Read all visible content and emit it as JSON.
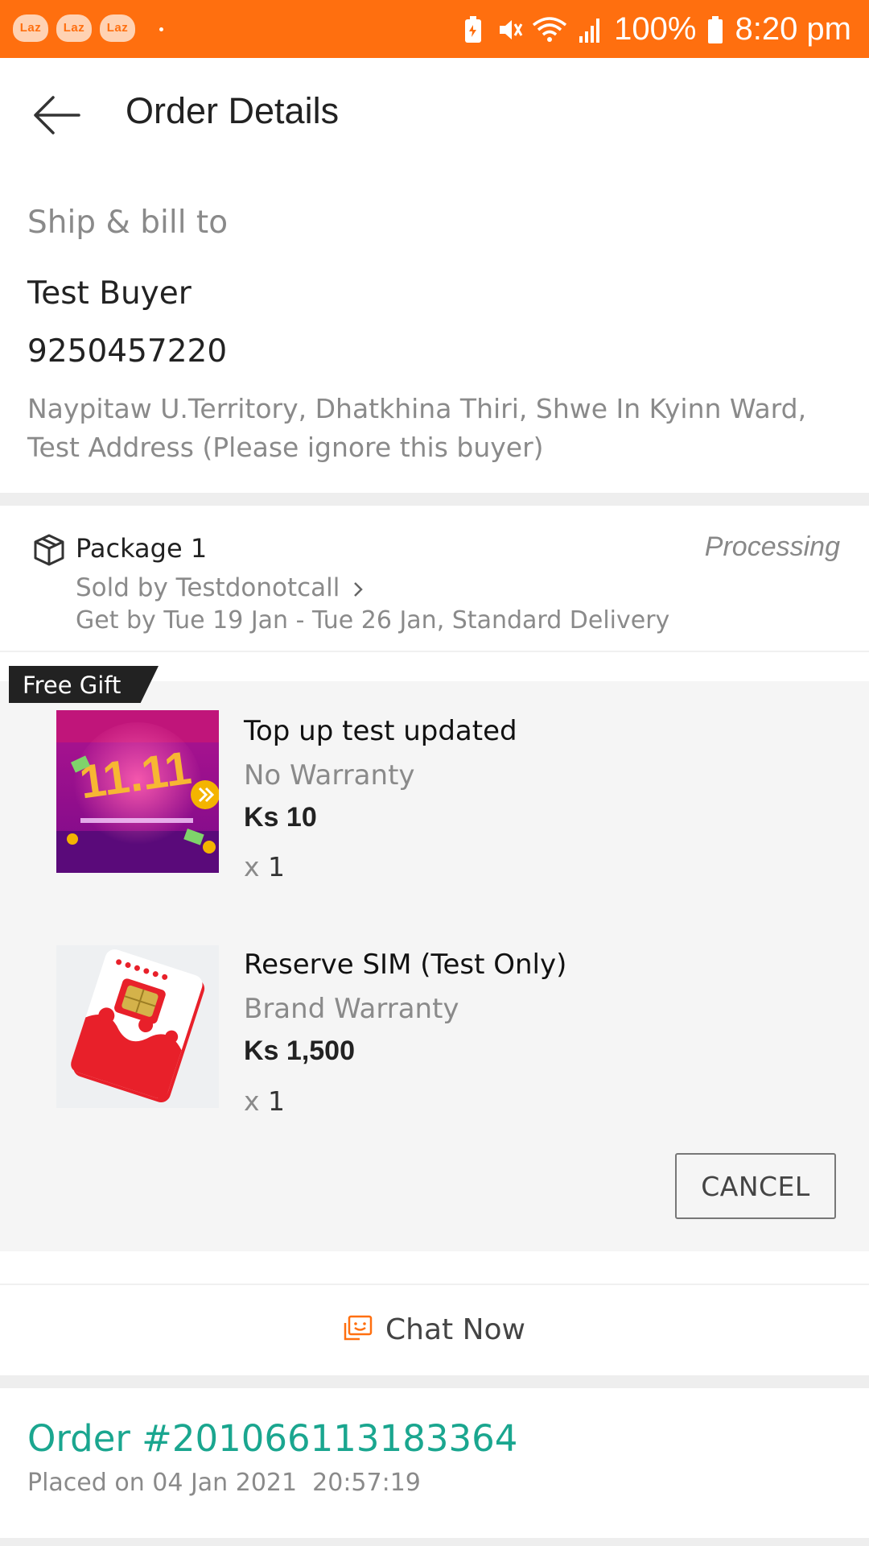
{
  "status_bar": {
    "app_icons": [
      "Laz",
      "Laz",
      "Laz"
    ],
    "battery": "100%",
    "time": "8:20 pm",
    "background": "#ff6f0f"
  },
  "header": {
    "back_icon": "arrow-left-icon",
    "title": "Order Details"
  },
  "shipping": {
    "label": "Ship & bill to",
    "name": "Test Buyer",
    "phone": "9250457220",
    "address": "Naypitaw U.Territory, Dhatkhina Thiri, Shwe In Kyinn Ward, Test Address (Please ignore this buyer)"
  },
  "package": {
    "icon": "package-box-icon",
    "title": "Package 1",
    "status": "Processing",
    "sold_by": "Sold by Testdonotcall",
    "delivery": "Get by Tue 19 Jan - Tue 26 Jan, Standard Delivery",
    "gift_tag": "Free Gift",
    "items": [
      {
        "name": "Top up test updated",
        "warranty": "No Warranty",
        "price": "Ks 10",
        "qty_prefix": "x",
        "qty": "1",
        "image_text": "11.11"
      },
      {
        "name": "Reserve SIM (Test Only)",
        "warranty": "Brand Warranty",
        "price": "Ks 1,500",
        "qty_prefix": "x",
        "qty": "1"
      }
    ],
    "cancel_label": "CANCEL"
  },
  "chat": {
    "icon": "chat-icon",
    "label": "Chat Now",
    "icon_color": "#ff6f0f"
  },
  "order": {
    "number": "Order #201066113183364",
    "placed": "Placed on 04 Jan 2021  20:57:19",
    "accent": "#1aa68f"
  }
}
